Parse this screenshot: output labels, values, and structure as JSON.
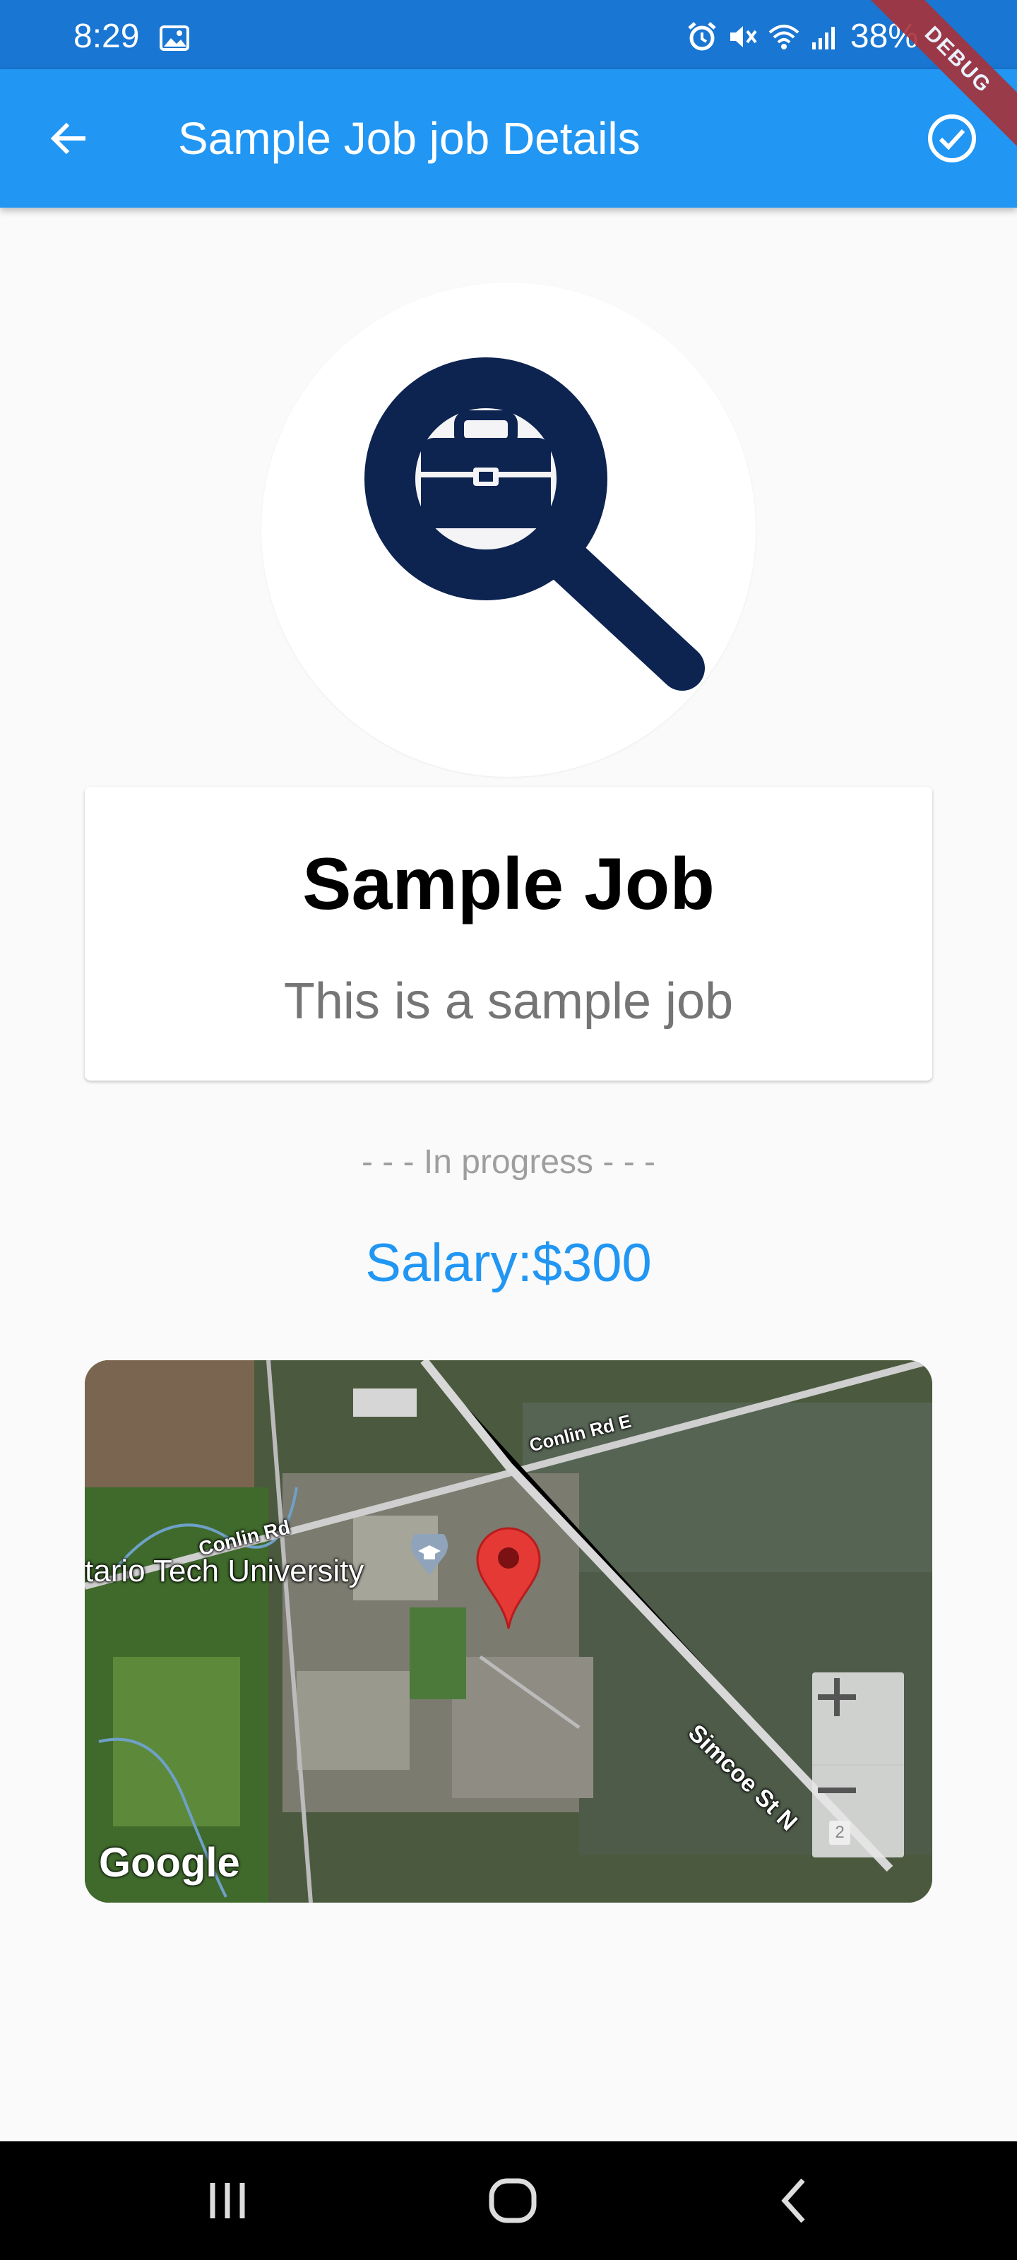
{
  "status_bar": {
    "time": "8:29",
    "battery": "38%",
    "icons": [
      "gallery-icon",
      "alarm-icon",
      "mute-icon",
      "wifi-icon",
      "signal-icon"
    ]
  },
  "app_bar": {
    "title": "Sample Job job Details",
    "back_icon": "arrow-left-icon",
    "action_icon": "check-circle-icon",
    "debug_banner": "DEBUG",
    "color": "#2196f3"
  },
  "avatar": {
    "icon": "job-search-icon",
    "color": "#0d2350"
  },
  "job": {
    "title": "Sample Job",
    "description": "This is a sample job",
    "status": "- - - In progress - - -",
    "salary": "Salary:$300"
  },
  "map": {
    "labels": {
      "conlin_rd_e": "Conlin Rd E",
      "conlin_rd": "Conlin Rd",
      "university": "tario Tech University",
      "simcoe": "Simcoe St N"
    },
    "zoom_in": "+",
    "zoom_out": "−",
    "attribution": "Google",
    "marker_color": "#e53935",
    "scale_badge": "2"
  },
  "nav_bar": {
    "recent_icon": "recent-apps-icon",
    "home_icon": "home-icon",
    "back_icon": "back-icon"
  }
}
